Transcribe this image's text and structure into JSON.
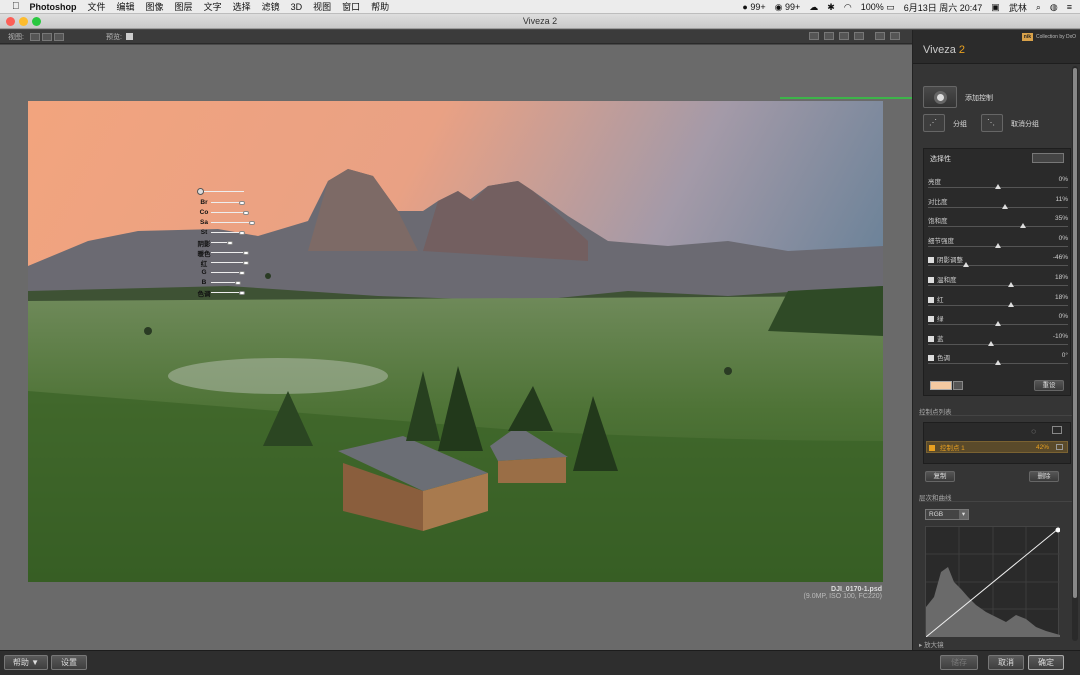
{
  "menubar": {
    "app": "Photoshop",
    "items": [
      "文件",
      "编辑",
      "图像",
      "图层",
      "文字",
      "选择",
      "滤镜",
      "3D",
      "视图",
      "窗口",
      "帮助"
    ],
    "status": {
      "qq": "99+",
      "wechat": "99+",
      "battery": "100%",
      "datetime": "6月13日 周六 20:47",
      "user": "武林"
    }
  },
  "window": {
    "title": "Viveza 2"
  },
  "toolbar": {
    "view_label": "视图:",
    "preview_label": "预览:"
  },
  "photo": {
    "filename": "DJI_0170-1.psd",
    "info": "(9.0MP, ISO 100, FC220)"
  },
  "control_point": {
    "labels": [
      "Br",
      "Co",
      "Sa",
      "St",
      "阴影",
      "暖色",
      "红",
      "G",
      "B",
      "色调"
    ]
  },
  "panel": {
    "title": "Viveza",
    "version": "2",
    "brand": "Collection by DxO",
    "add_control": "添加控制",
    "group": "分组",
    "ungroup": "取消分组",
    "selectivity": "选择性",
    "sliders": [
      {
        "label": "亮度",
        "value": "0%",
        "pos": 0.5,
        "check": false
      },
      {
        "label": "对比度",
        "value": "11%",
        "pos": 0.55,
        "check": false
      },
      {
        "label": "饱和度",
        "value": "35%",
        "pos": 0.68,
        "check": false
      },
      {
        "label": "细节强度",
        "value": "0%",
        "pos": 0.5,
        "check": false
      },
      {
        "label": "阴影调整",
        "value": "-46%",
        "pos": 0.27,
        "check": true
      },
      {
        "label": "温和度",
        "value": "18%",
        "pos": 0.59,
        "check": true
      },
      {
        "label": "红",
        "value": "18%",
        "pos": 0.59,
        "check": true
      },
      {
        "label": "绿",
        "value": "0%",
        "pos": 0.5,
        "check": true
      },
      {
        "label": "蓝",
        "value": "-10%",
        "pos": 0.45,
        "check": true
      },
      {
        "label": "色调",
        "value": "0°",
        "pos": 0.5,
        "check": true
      }
    ],
    "reset": "重设",
    "control_list": "控制点列表",
    "list_item": {
      "name": "控制点 1",
      "value": "42%"
    },
    "duplicate": "复制",
    "delete": "删除",
    "levels": "层次和曲线",
    "channel": "RGB",
    "loupe": "放大镜"
  },
  "bottom": {
    "help": "帮助 ▼",
    "settings": "设置",
    "save": "储存",
    "cancel": "取消",
    "ok": "确定"
  },
  "colors": {
    "accent": "#e8a020",
    "arrow": "#2ecc40"
  }
}
